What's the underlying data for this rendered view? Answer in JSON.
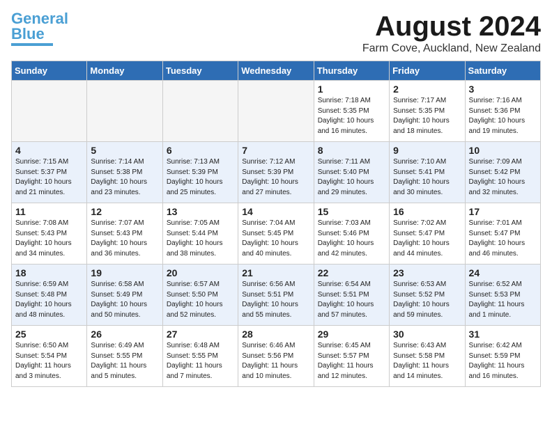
{
  "logo": {
    "line1": "General",
    "line2": "Blue"
  },
  "title": "August 2024",
  "location": "Farm Cove, Auckland, New Zealand",
  "days_of_week": [
    "Sunday",
    "Monday",
    "Tuesday",
    "Wednesday",
    "Thursday",
    "Friday",
    "Saturday"
  ],
  "weeks": [
    [
      {
        "day": "",
        "empty": true
      },
      {
        "day": "",
        "empty": true
      },
      {
        "day": "",
        "empty": true
      },
      {
        "day": "",
        "empty": true
      },
      {
        "day": "1",
        "sunrise": "7:18 AM",
        "sunset": "5:35 PM",
        "daylight": "10 hours and 16 minutes."
      },
      {
        "day": "2",
        "sunrise": "7:17 AM",
        "sunset": "5:35 PM",
        "daylight": "10 hours and 18 minutes."
      },
      {
        "day": "3",
        "sunrise": "7:16 AM",
        "sunset": "5:36 PM",
        "daylight": "10 hours and 19 minutes."
      }
    ],
    [
      {
        "day": "4",
        "sunrise": "7:15 AM",
        "sunset": "5:37 PM",
        "daylight": "10 hours and 21 minutes."
      },
      {
        "day": "5",
        "sunrise": "7:14 AM",
        "sunset": "5:38 PM",
        "daylight": "10 hours and 23 minutes."
      },
      {
        "day": "6",
        "sunrise": "7:13 AM",
        "sunset": "5:39 PM",
        "daylight": "10 hours and 25 minutes."
      },
      {
        "day": "7",
        "sunrise": "7:12 AM",
        "sunset": "5:39 PM",
        "daylight": "10 hours and 27 minutes."
      },
      {
        "day": "8",
        "sunrise": "7:11 AM",
        "sunset": "5:40 PM",
        "daylight": "10 hours and 29 minutes."
      },
      {
        "day": "9",
        "sunrise": "7:10 AM",
        "sunset": "5:41 PM",
        "daylight": "10 hours and 30 minutes."
      },
      {
        "day": "10",
        "sunrise": "7:09 AM",
        "sunset": "5:42 PM",
        "daylight": "10 hours and 32 minutes."
      }
    ],
    [
      {
        "day": "11",
        "sunrise": "7:08 AM",
        "sunset": "5:43 PM",
        "daylight": "10 hours and 34 minutes."
      },
      {
        "day": "12",
        "sunrise": "7:07 AM",
        "sunset": "5:43 PM",
        "daylight": "10 hours and 36 minutes."
      },
      {
        "day": "13",
        "sunrise": "7:05 AM",
        "sunset": "5:44 PM",
        "daylight": "10 hours and 38 minutes."
      },
      {
        "day": "14",
        "sunrise": "7:04 AM",
        "sunset": "5:45 PM",
        "daylight": "10 hours and 40 minutes."
      },
      {
        "day": "15",
        "sunrise": "7:03 AM",
        "sunset": "5:46 PM",
        "daylight": "10 hours and 42 minutes."
      },
      {
        "day": "16",
        "sunrise": "7:02 AM",
        "sunset": "5:47 PM",
        "daylight": "10 hours and 44 minutes."
      },
      {
        "day": "17",
        "sunrise": "7:01 AM",
        "sunset": "5:47 PM",
        "daylight": "10 hours and 46 minutes."
      }
    ],
    [
      {
        "day": "18",
        "sunrise": "6:59 AM",
        "sunset": "5:48 PM",
        "daylight": "10 hours and 48 minutes."
      },
      {
        "day": "19",
        "sunrise": "6:58 AM",
        "sunset": "5:49 PM",
        "daylight": "10 hours and 50 minutes."
      },
      {
        "day": "20",
        "sunrise": "6:57 AM",
        "sunset": "5:50 PM",
        "daylight": "10 hours and 52 minutes."
      },
      {
        "day": "21",
        "sunrise": "6:56 AM",
        "sunset": "5:51 PM",
        "daylight": "10 hours and 55 minutes."
      },
      {
        "day": "22",
        "sunrise": "6:54 AM",
        "sunset": "5:51 PM",
        "daylight": "10 hours and 57 minutes."
      },
      {
        "day": "23",
        "sunrise": "6:53 AM",
        "sunset": "5:52 PM",
        "daylight": "10 hours and 59 minutes."
      },
      {
        "day": "24",
        "sunrise": "6:52 AM",
        "sunset": "5:53 PM",
        "daylight": "11 hours and 1 minute."
      }
    ],
    [
      {
        "day": "25",
        "sunrise": "6:50 AM",
        "sunset": "5:54 PM",
        "daylight": "11 hours and 3 minutes."
      },
      {
        "day": "26",
        "sunrise": "6:49 AM",
        "sunset": "5:55 PM",
        "daylight": "11 hours and 5 minutes."
      },
      {
        "day": "27",
        "sunrise": "6:48 AM",
        "sunset": "5:55 PM",
        "daylight": "11 hours and 7 minutes."
      },
      {
        "day": "28",
        "sunrise": "6:46 AM",
        "sunset": "5:56 PM",
        "daylight": "11 hours and 10 minutes."
      },
      {
        "day": "29",
        "sunrise": "6:45 AM",
        "sunset": "5:57 PM",
        "daylight": "11 hours and 12 minutes."
      },
      {
        "day": "30",
        "sunrise": "6:43 AM",
        "sunset": "5:58 PM",
        "daylight": "11 hours and 14 minutes."
      },
      {
        "day": "31",
        "sunrise": "6:42 AM",
        "sunset": "5:59 PM",
        "daylight": "11 hours and 16 minutes."
      }
    ]
  ]
}
